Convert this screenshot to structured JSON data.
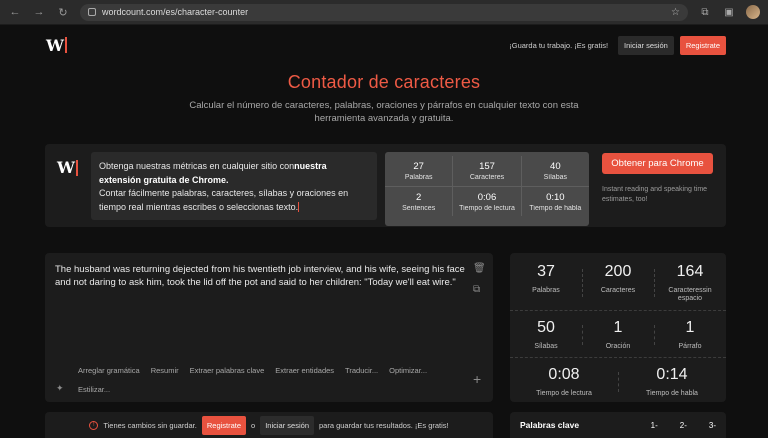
{
  "browser": {
    "url": "wordcount.com/es/character-counter"
  },
  "header": {
    "logo_text": "W",
    "save_message": "¡Guarda tu trabajo. ¡Es gratis!",
    "login_label": "Iniciar sesión",
    "register_label": "Registrate"
  },
  "hero": {
    "title": "Contador de caracteres",
    "subtitle": "Calcular el número de caracteres, palabras, oraciones y párrafos en cualquier texto con esta herramienta avanzada y gratuita."
  },
  "promo": {
    "logo_text": "W",
    "text_part1": "Obtenga nuestras métricas en cualquier sitio con",
    "text_bold": "nuestra extensión gratuita de Chrome.",
    "text_part2": "Contar fácilmente palabras, caracteres, sílabas y oraciones en tiempo real mientras escribes o seleccionas texto.",
    "stats": [
      {
        "value": "27",
        "label": "Palabras"
      },
      {
        "value": "157",
        "label": "Caracteres"
      },
      {
        "value": "40",
        "label": "Sílabas"
      },
      {
        "value": "2",
        "label": "Sentences"
      },
      {
        "value": "0:06",
        "label": "Tiempo de lectura"
      },
      {
        "value": "0:10",
        "label": "Tiempo de habla"
      }
    ],
    "chrome_button": "Obtener para Chrome",
    "note": "Instant reading and speaking time estimates, too!"
  },
  "editor": {
    "text": "The husband was returning dejected from his twentieth job interview, and his wife, seeing his face and not daring to ask him, took the lid off the pot and said to her children: \"Today we'll eat wire.\"",
    "tools": [
      "Arreglar gramática",
      "Resumir",
      "Extraer palabras clave",
      "Extraer entidades",
      "Traducir...",
      "Optimizar..."
    ],
    "tool_style": "Estilizar..."
  },
  "stats": {
    "row1": [
      {
        "value": "37",
        "label": "Palabras"
      },
      {
        "value": "200",
        "label": "Caracteres"
      },
      {
        "value": "164",
        "label": "Caracteressin espacio"
      }
    ],
    "row2": [
      {
        "value": "50",
        "label": "Sílabas"
      },
      {
        "value": "1",
        "label": "Oración"
      },
      {
        "value": "1",
        "label": "Párrafo"
      }
    ],
    "row3": [
      {
        "value": "0:08",
        "label": "Tiempo de lectura"
      },
      {
        "value": "0:14",
        "label": "Tiempo de habla"
      }
    ]
  },
  "unsaved": {
    "message": "Tienes cambios sin guardar.",
    "register_label": "Registrate",
    "or": "o",
    "login_label": "Iniciar sesión",
    "suffix": "para guardar tus resultados. ¡Es gratis!"
  },
  "keywords": {
    "title": "Palabras clave",
    "options": [
      "1-",
      "2-",
      "3-"
    ]
  }
}
